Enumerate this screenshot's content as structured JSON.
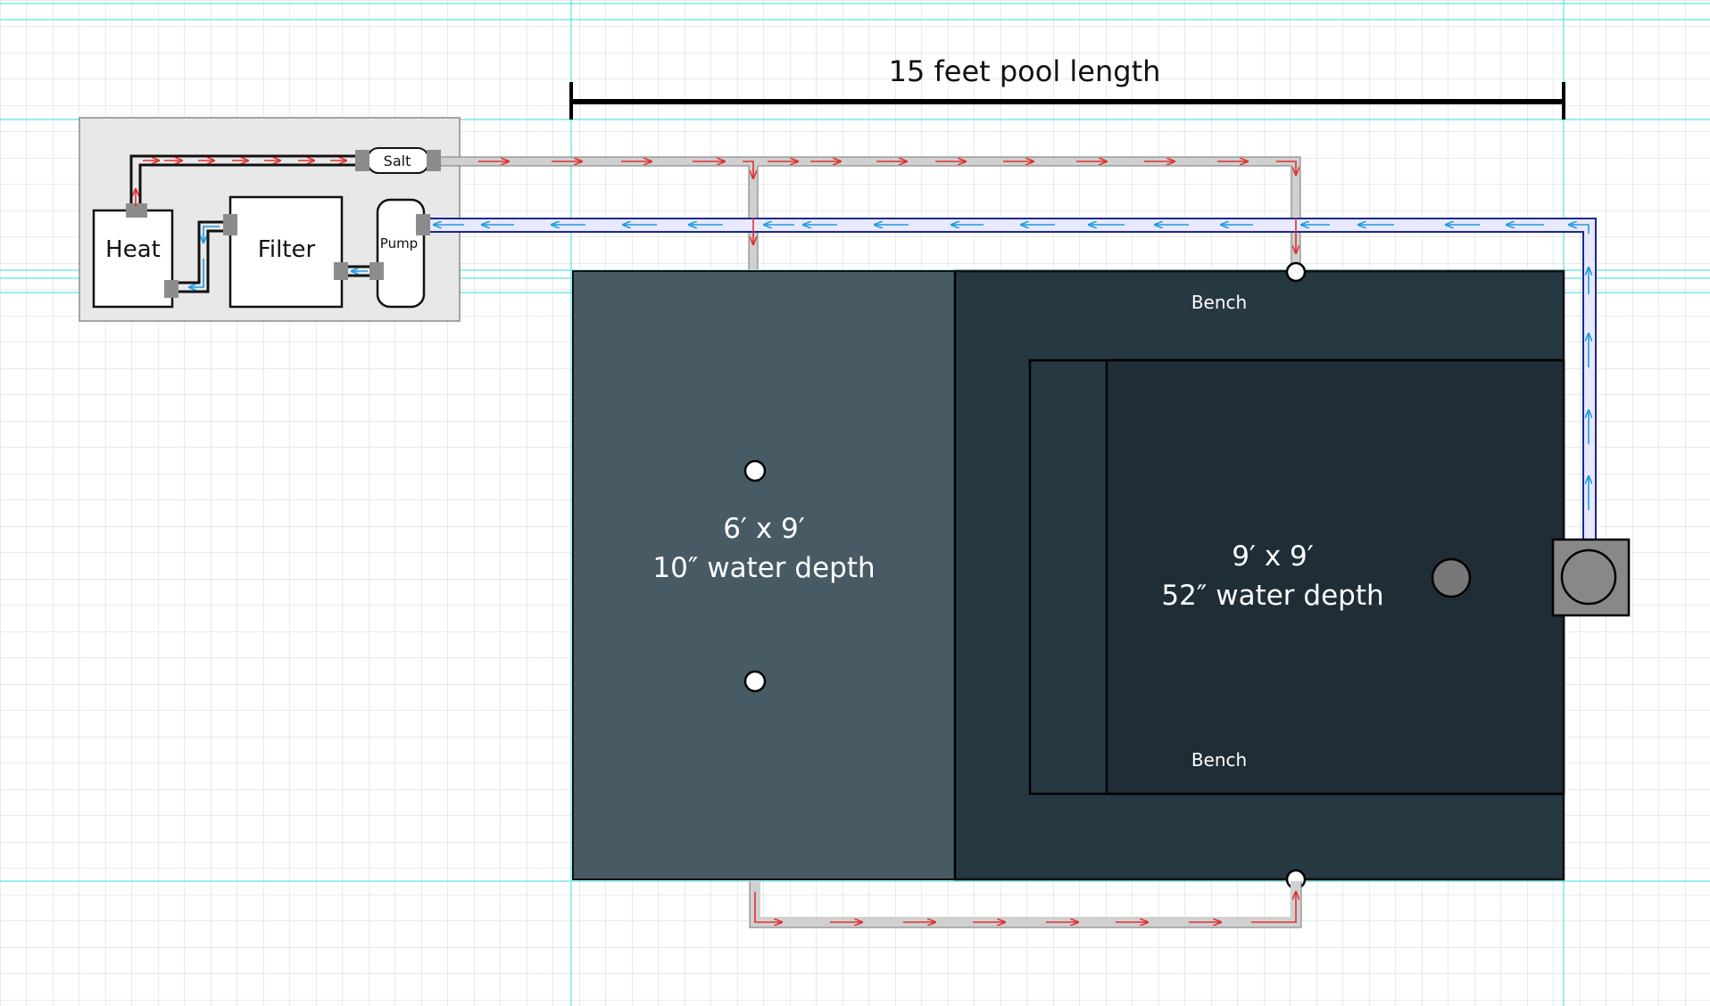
{
  "dimension": {
    "label": "15 feet pool length"
  },
  "equipment": {
    "salt_label": "Salt",
    "heat_label": "Heat",
    "filter_label": "Filter",
    "pump_label": "Pump"
  },
  "pool": {
    "shallow": {
      "size": "6′ x 9′",
      "depth": "10″ water depth"
    },
    "deep": {
      "size": "9′ x 9′",
      "depth": "52″ water depth"
    },
    "bench_top": "Bench",
    "bench_bottom": "Bench"
  },
  "colors": {
    "grid_minor": "#d6d6d6",
    "guide": "#5fe3e3",
    "equipment_bg": "#e8e8e8",
    "shallow_water": "#485b65",
    "deep_water": "#263841",
    "deep_well": "#1f2e36",
    "pipe": "#d0d0d0",
    "supply_arrow": "#e03030",
    "return_arrow": "#1e9be0",
    "return_line": "#1c2a8a",
    "fitting": "#8c8c8c"
  }
}
